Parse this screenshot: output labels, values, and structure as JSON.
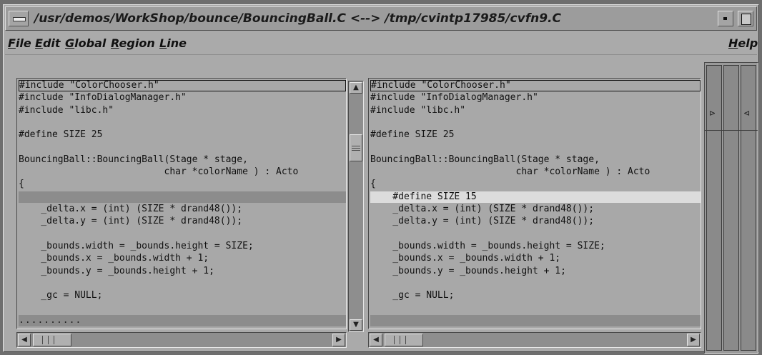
{
  "window": {
    "title": "/usr/demos/WorkShop/bounce/BouncingBall.C <--> /tmp/cvintp17985/cvfn9.C"
  },
  "menubar": {
    "items": [
      {
        "label": "File",
        "mnemonic": "F",
        "rest": "ile"
      },
      {
        "label": "Edit",
        "mnemonic": "E",
        "rest": "dit"
      },
      {
        "label": "Global",
        "mnemonic": "G",
        "rest": "lobal"
      },
      {
        "label": "Region",
        "mnemonic": "R",
        "rest": "egion"
      },
      {
        "label": "Line",
        "mnemonic": "L",
        "rest": "ine"
      }
    ],
    "help": {
      "label": "Help",
      "mnemonic": "H",
      "rest": "elp"
    }
  },
  "left_pane": {
    "lines": [
      {
        "text": "#include \"ColorChooser.h\"",
        "style": "boxed"
      },
      {
        "text": "#include \"InfoDialogManager.h\"",
        "style": ""
      },
      {
        "text": "#include \"libc.h\"",
        "style": ""
      },
      {
        "text": "",
        "style": ""
      },
      {
        "text": "#define SIZE 25",
        "style": ""
      },
      {
        "text": "",
        "style": ""
      },
      {
        "text": "BouncingBall::BouncingBall(Stage * stage,",
        "style": ""
      },
      {
        "text": "                          char *colorName ) : Acto",
        "style": ""
      },
      {
        "text": "{",
        "style": ""
      },
      {
        "text": "",
        "style": "dark"
      },
      {
        "text": "    _delta.x = (int) (SIZE * drand48());",
        "style": ""
      },
      {
        "text": "    _delta.y = (int) (SIZE * drand48());",
        "style": ""
      },
      {
        "text": "",
        "style": ""
      },
      {
        "text": "    _bounds.width = _bounds.height = SIZE;",
        "style": ""
      },
      {
        "text": "    _bounds.x = _bounds.width + 1;",
        "style": ""
      },
      {
        "text": "    _bounds.y = _bounds.height + 1;",
        "style": ""
      },
      {
        "text": "",
        "style": ""
      },
      {
        "text": "    _gc = NULL;",
        "style": ""
      },
      {
        "text": "",
        "style": ""
      },
      {
        "text": "",
        "style": "dark-dots"
      }
    ]
  },
  "right_pane": {
    "lines": [
      {
        "text": "#include \"ColorChooser.h\"",
        "style": "boxed"
      },
      {
        "text": "#include \"InfoDialogManager.h\"",
        "style": ""
      },
      {
        "text": "#include \"libc.h\"",
        "style": ""
      },
      {
        "text": "",
        "style": ""
      },
      {
        "text": "#define SIZE 25",
        "style": ""
      },
      {
        "text": "",
        "style": ""
      },
      {
        "text": "BouncingBall::BouncingBall(Stage * stage,",
        "style": ""
      },
      {
        "text": "                          char *colorName ) : Acto",
        "style": ""
      },
      {
        "text": "{",
        "style": ""
      },
      {
        "text": "    #define SIZE 15",
        "style": "light"
      },
      {
        "text": "    _delta.x = (int) (SIZE * drand48());",
        "style": ""
      },
      {
        "text": "    _delta.y = (int) (SIZE * drand48());",
        "style": ""
      },
      {
        "text": "",
        "style": ""
      },
      {
        "text": "    _bounds.width = _bounds.height = SIZE;",
        "style": ""
      },
      {
        "text": "    _bounds.x = _bounds.width + 1;",
        "style": ""
      },
      {
        "text": "    _bounds.y = _bounds.height + 1;",
        "style": ""
      },
      {
        "text": "",
        "style": ""
      },
      {
        "text": "    _gc = NULL;",
        "style": ""
      },
      {
        "text": "",
        "style": ""
      },
      {
        "text": "",
        "style": "dark"
      }
    ]
  },
  "dots_text": "..........",
  "icons": {
    "up": "▲",
    "down": "▼",
    "left": "◀",
    "right": "▶",
    "ov_right": "⊳",
    "ov_left": "⊲"
  }
}
